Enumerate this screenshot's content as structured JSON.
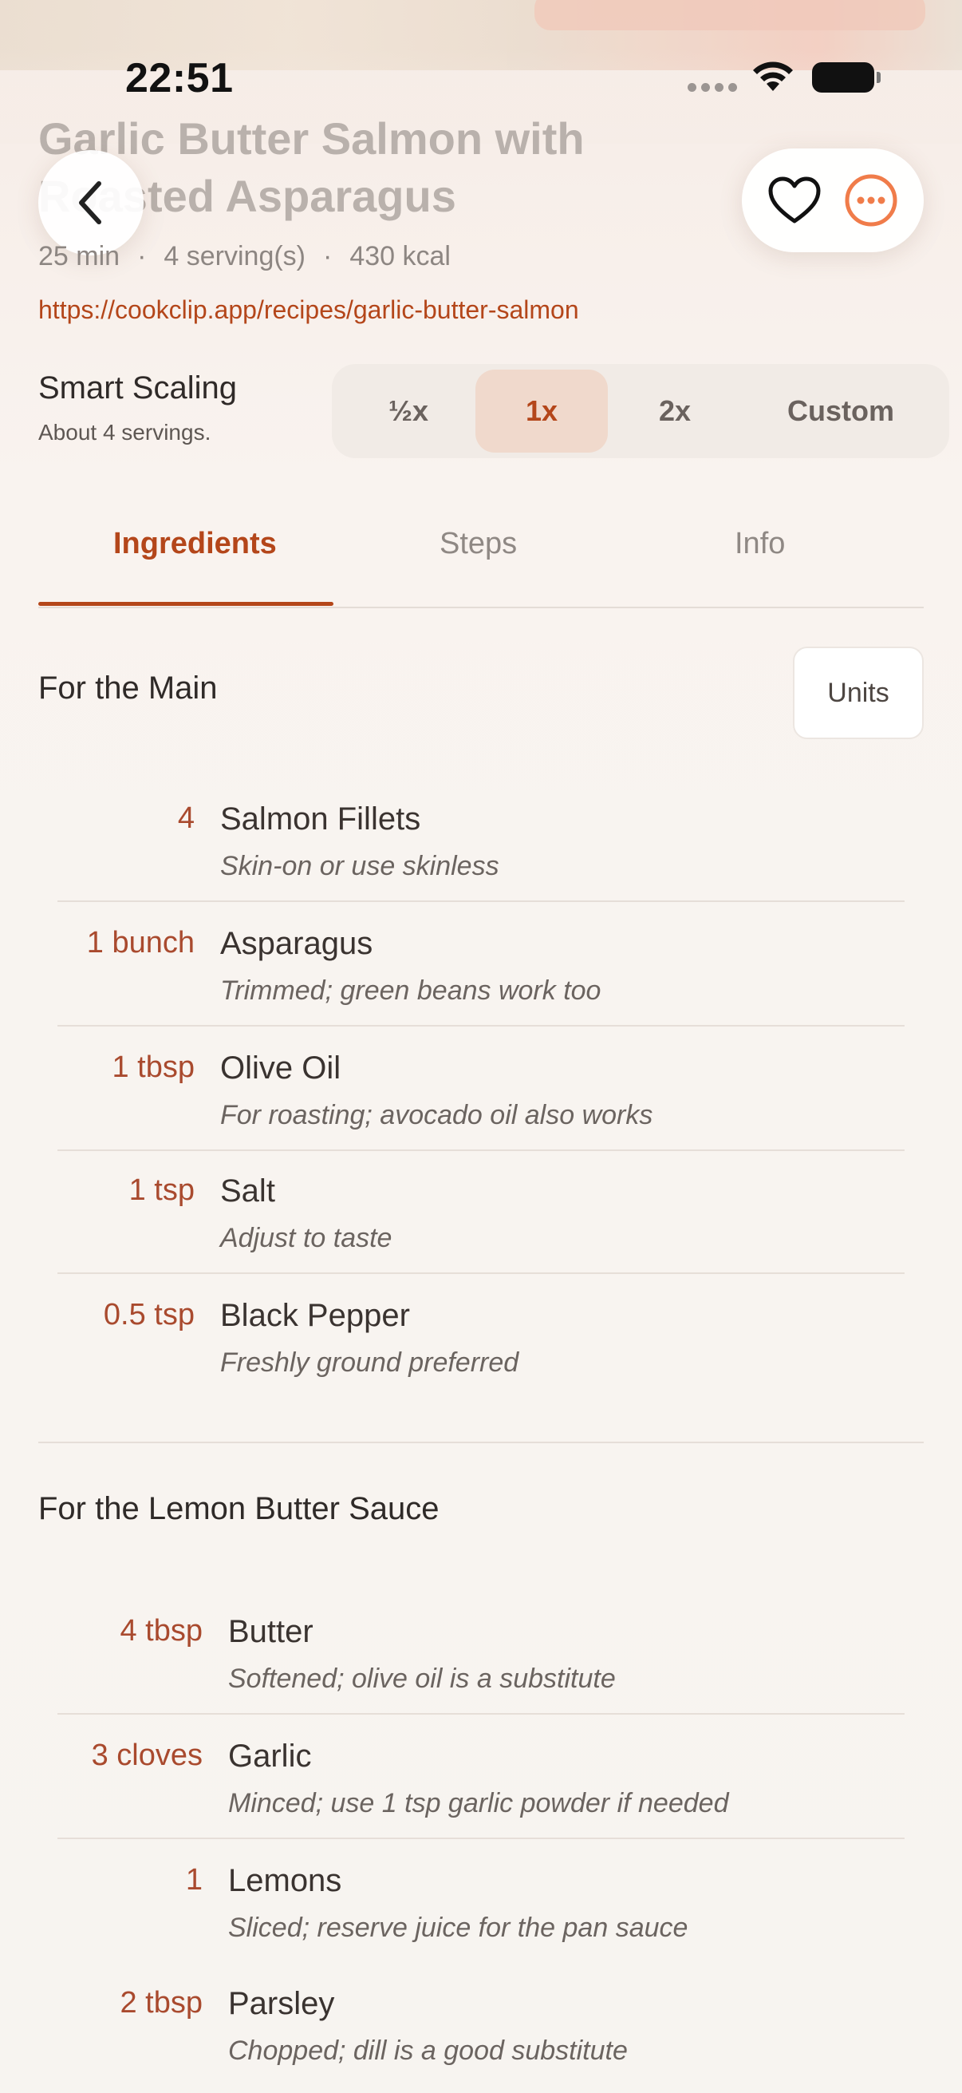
{
  "status": {
    "time": "22:51"
  },
  "recipe": {
    "title": "Garlic Butter Salmon with Roasted Asparagus",
    "meta": {
      "time": "25 min",
      "servings": "4 serving(s)",
      "calories": "430 kcal",
      "separator": "·"
    },
    "url": "https://cookclip.app/recipes/garlic-butter-salmon"
  },
  "scaling": {
    "title": "Smart Scaling",
    "subtitle": "About 4 servings.",
    "options": [
      "½x",
      "1x",
      "2x",
      "Custom"
    ],
    "selected": "1x"
  },
  "tabs": {
    "ingredients": "Ingredients",
    "steps": "Steps",
    "info": "Info",
    "active": "Ingredients"
  },
  "units_label": "Units",
  "sections": [
    {
      "title": "For the Main",
      "items": [
        {
          "qty": "4",
          "name": "Salmon Fillets",
          "note": "Skin-on or use skinless"
        },
        {
          "qty": "1 bunch",
          "name": "Asparagus",
          "note": "Trimmed; green beans work too"
        },
        {
          "qty": "1 tbsp",
          "name": "Olive Oil",
          "note": "For roasting; avocado oil also works"
        },
        {
          "qty": "1 tsp",
          "name": "Salt",
          "note": "Adjust to taste"
        },
        {
          "qty": "0.5 tsp",
          "name": "Black Pepper",
          "note": "Freshly ground preferred"
        }
      ]
    },
    {
      "title": "For the Lemon Butter Sauce",
      "items": [
        {
          "qty": "4 tbsp",
          "name": "Butter",
          "note": "Softened; olive oil is a substitute"
        },
        {
          "qty": "3 cloves",
          "name": "Garlic",
          "note": "Minced; use 1 tsp garlic powder if needed"
        },
        {
          "qty": "1",
          "name": "Lemons",
          "note": "Sliced; reserve juice for the pan sauce"
        },
        {
          "qty": "2 tbsp",
          "name": "Parsley",
          "note": "Chopped; dill is a good substitute"
        }
      ]
    }
  ],
  "icons": {
    "back": "chevron-left-icon",
    "favorite": "heart-icon",
    "more": "ellipsis-circle-icon",
    "accent": "#b4461a",
    "more_color": "#f07c4a"
  }
}
